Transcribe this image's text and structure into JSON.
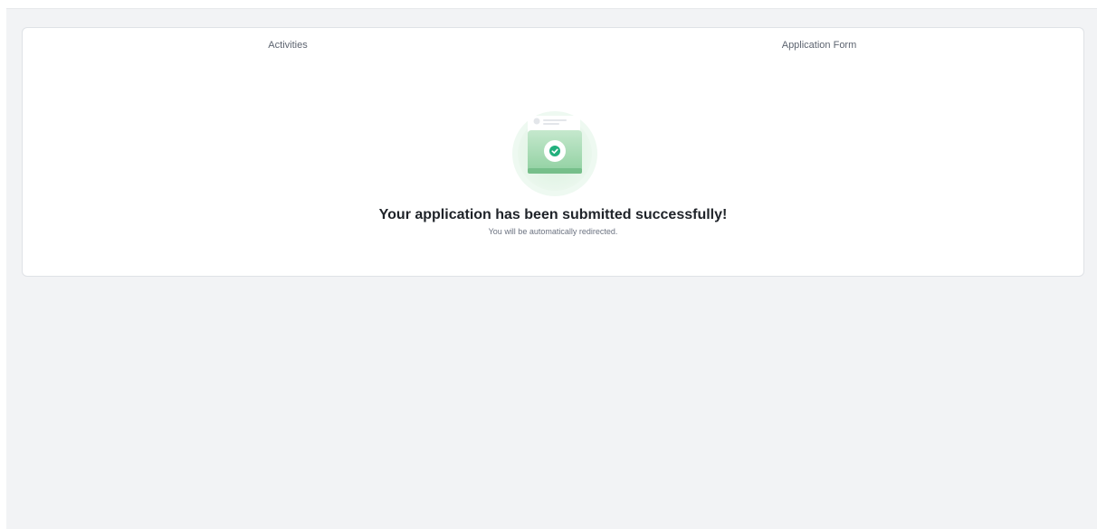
{
  "tabs": {
    "left_label": "Activities",
    "right_label": "Application Form"
  },
  "success": {
    "title": "Your application has been submitted successfully!",
    "subtitle": "You will be automatically redirected."
  },
  "colors": {
    "accent_green": "#22b07d",
    "illustration_green": "#a7d8b2",
    "background": "#f2f3f5"
  },
  "icons": {
    "illustration": "submitted-folder-check-icon"
  }
}
